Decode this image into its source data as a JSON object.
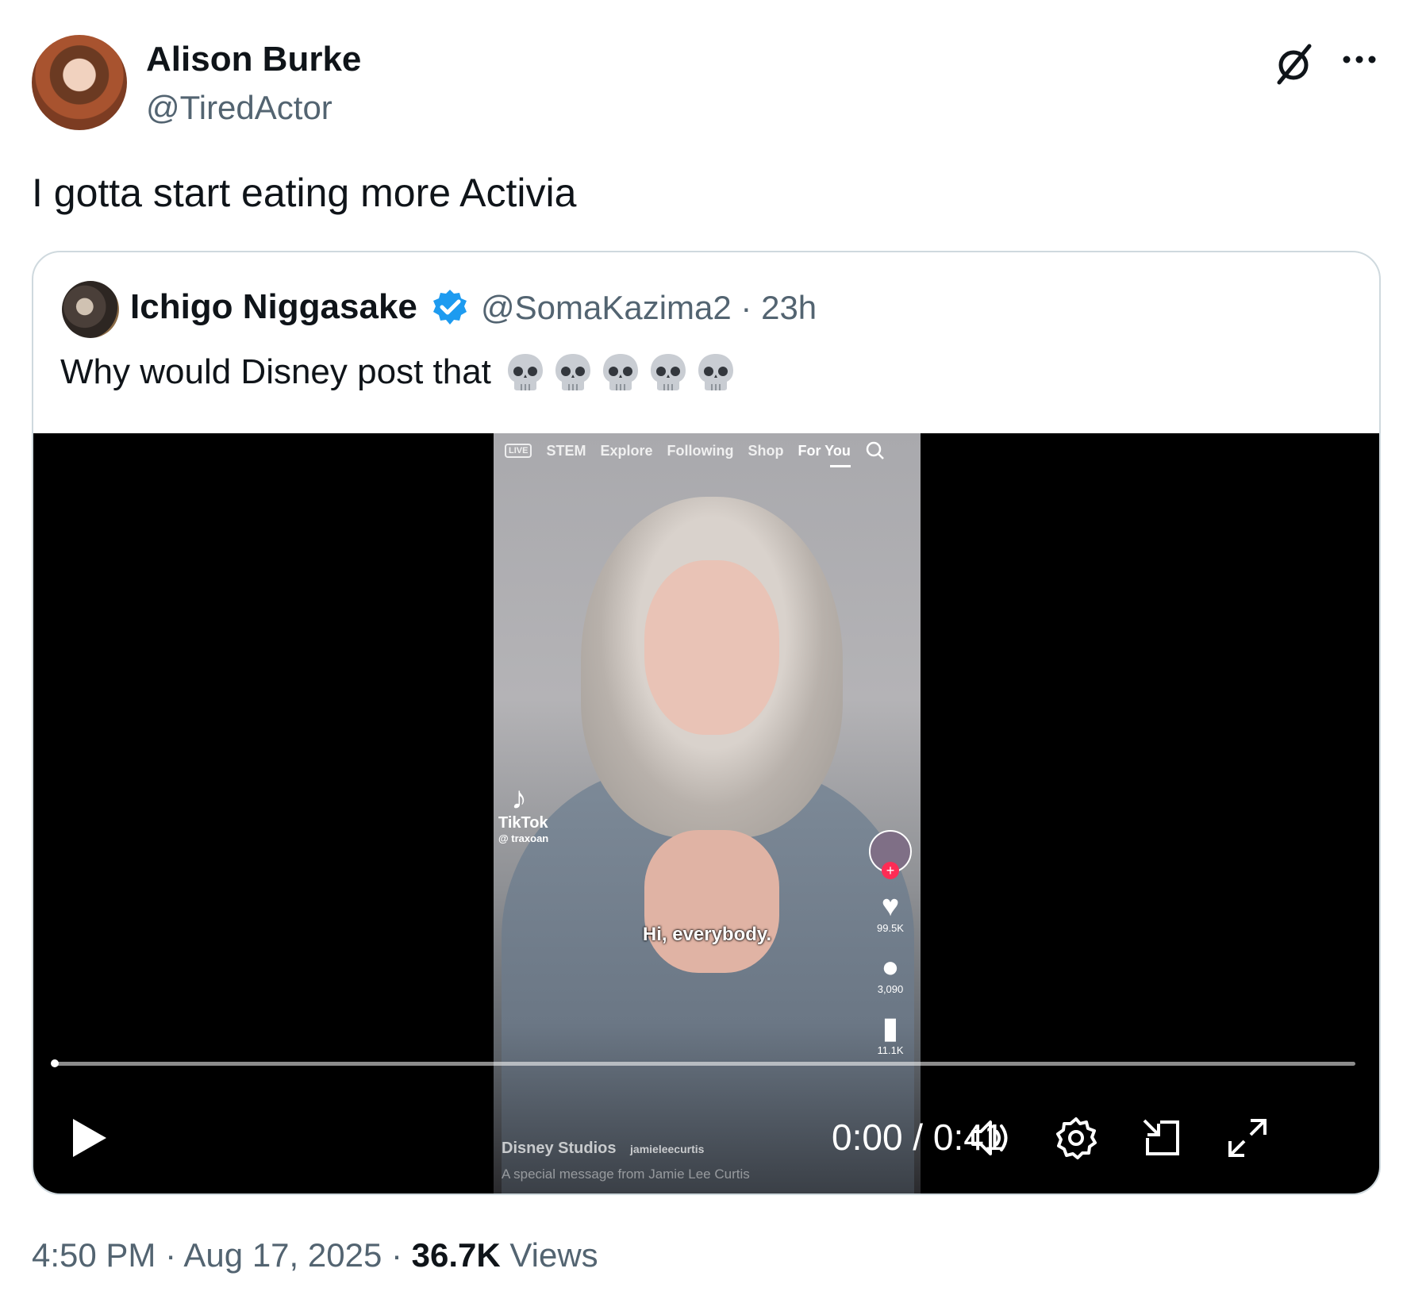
{
  "author": {
    "name": "Alison Burke",
    "handle": "@TiredActor"
  },
  "tweet": {
    "text": "I gotta start eating more Activia"
  },
  "quote": {
    "name": "Ichigo Niggasake",
    "handle_time": "@SomaKazima2 · 23h",
    "text": "Why would Disney post that",
    "emoji_count": 5
  },
  "video": {
    "tiktok_nav": {
      "live": "LIVE",
      "items": [
        "STEM",
        "Explore",
        "Following",
        "Shop",
        "For You"
      ]
    },
    "tiktok_logo": "TikTok",
    "tiktok_user": "@ traxoan",
    "caption": "Hi, everybody.",
    "likes": "99.5K",
    "comments": "3,090",
    "saves": "11.1K",
    "channel": "Disney Studios",
    "collab": "jamieleecurtis",
    "description": "A special message from Jamie Lee Curtis",
    "current_time": "0:00",
    "duration": "0:41",
    "time_display": "0:00 / 0:41",
    "progress": 0
  },
  "footer": {
    "timestamp": "4:50 PM · Aug 17, 2025 · ",
    "views_count": "36.7K",
    "views_label": " Views"
  },
  "colors": {
    "text_primary": "#0f1419",
    "text_secondary": "#536471",
    "verified": "#1d9bf0",
    "border": "#cfd9de"
  }
}
